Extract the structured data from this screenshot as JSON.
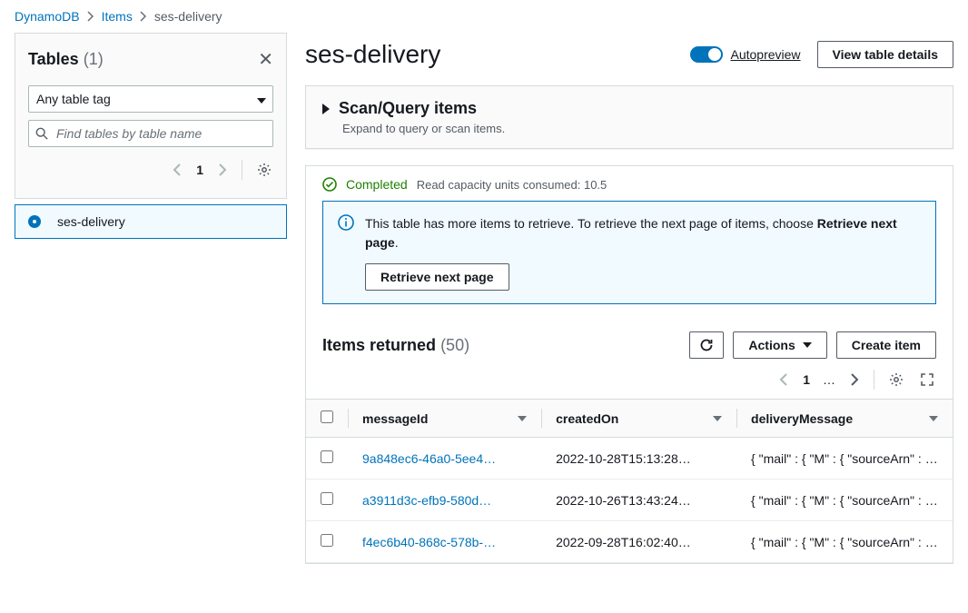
{
  "breadcrumb": {
    "root": "DynamoDB",
    "mid": "Items",
    "current": "ses-delivery"
  },
  "sidebar": {
    "title": "Tables",
    "count": "(1)",
    "tag_select": "Any table tag",
    "search_placeholder": "Find tables by table name",
    "page": "1",
    "items": [
      {
        "name": "ses-delivery"
      }
    ]
  },
  "page": {
    "title": "ses-delivery",
    "autopreview": "Autopreview",
    "view_details": "View table details"
  },
  "scan": {
    "title": "Scan/Query items",
    "sub": "Expand to query or scan items."
  },
  "status": {
    "label": "Completed",
    "meta": "Read capacity units consumed: 10.5"
  },
  "info": {
    "text_a": "This table has more items to retrieve. To retrieve the next page of items, choose ",
    "text_b": "Retrieve next page",
    "text_c": ".",
    "btn": "Retrieve next page"
  },
  "items": {
    "title": "Items returned",
    "count": "(50)",
    "actions_label": "Actions",
    "create_label": "Create item",
    "page": "1",
    "ellipsis": "…",
    "columns": {
      "c1": "messageId",
      "c2": "createdOn",
      "c3": "deliveryMessage"
    },
    "rows": [
      {
        "id": "9a848ec6-46a0-5ee4…",
        "created": "2022-10-28T15:13:28…",
        "msg": "{ \"mail\" : { \"M\" : { \"sourceArn\" : { \"S\" :…"
      },
      {
        "id": "a3911d3c-efb9-580d…",
        "created": "2022-10-26T13:43:24…",
        "msg": "{ \"mail\" : { \"M\" : { \"sourceArn\" : { \"S\" :…"
      },
      {
        "id": "f4ec6b40-868c-578b-…",
        "created": "2022-09-28T16:02:40…",
        "msg": "{ \"mail\" : { \"M\" : { \"sourceArn\" : { \"S\" :…"
      }
    ]
  }
}
